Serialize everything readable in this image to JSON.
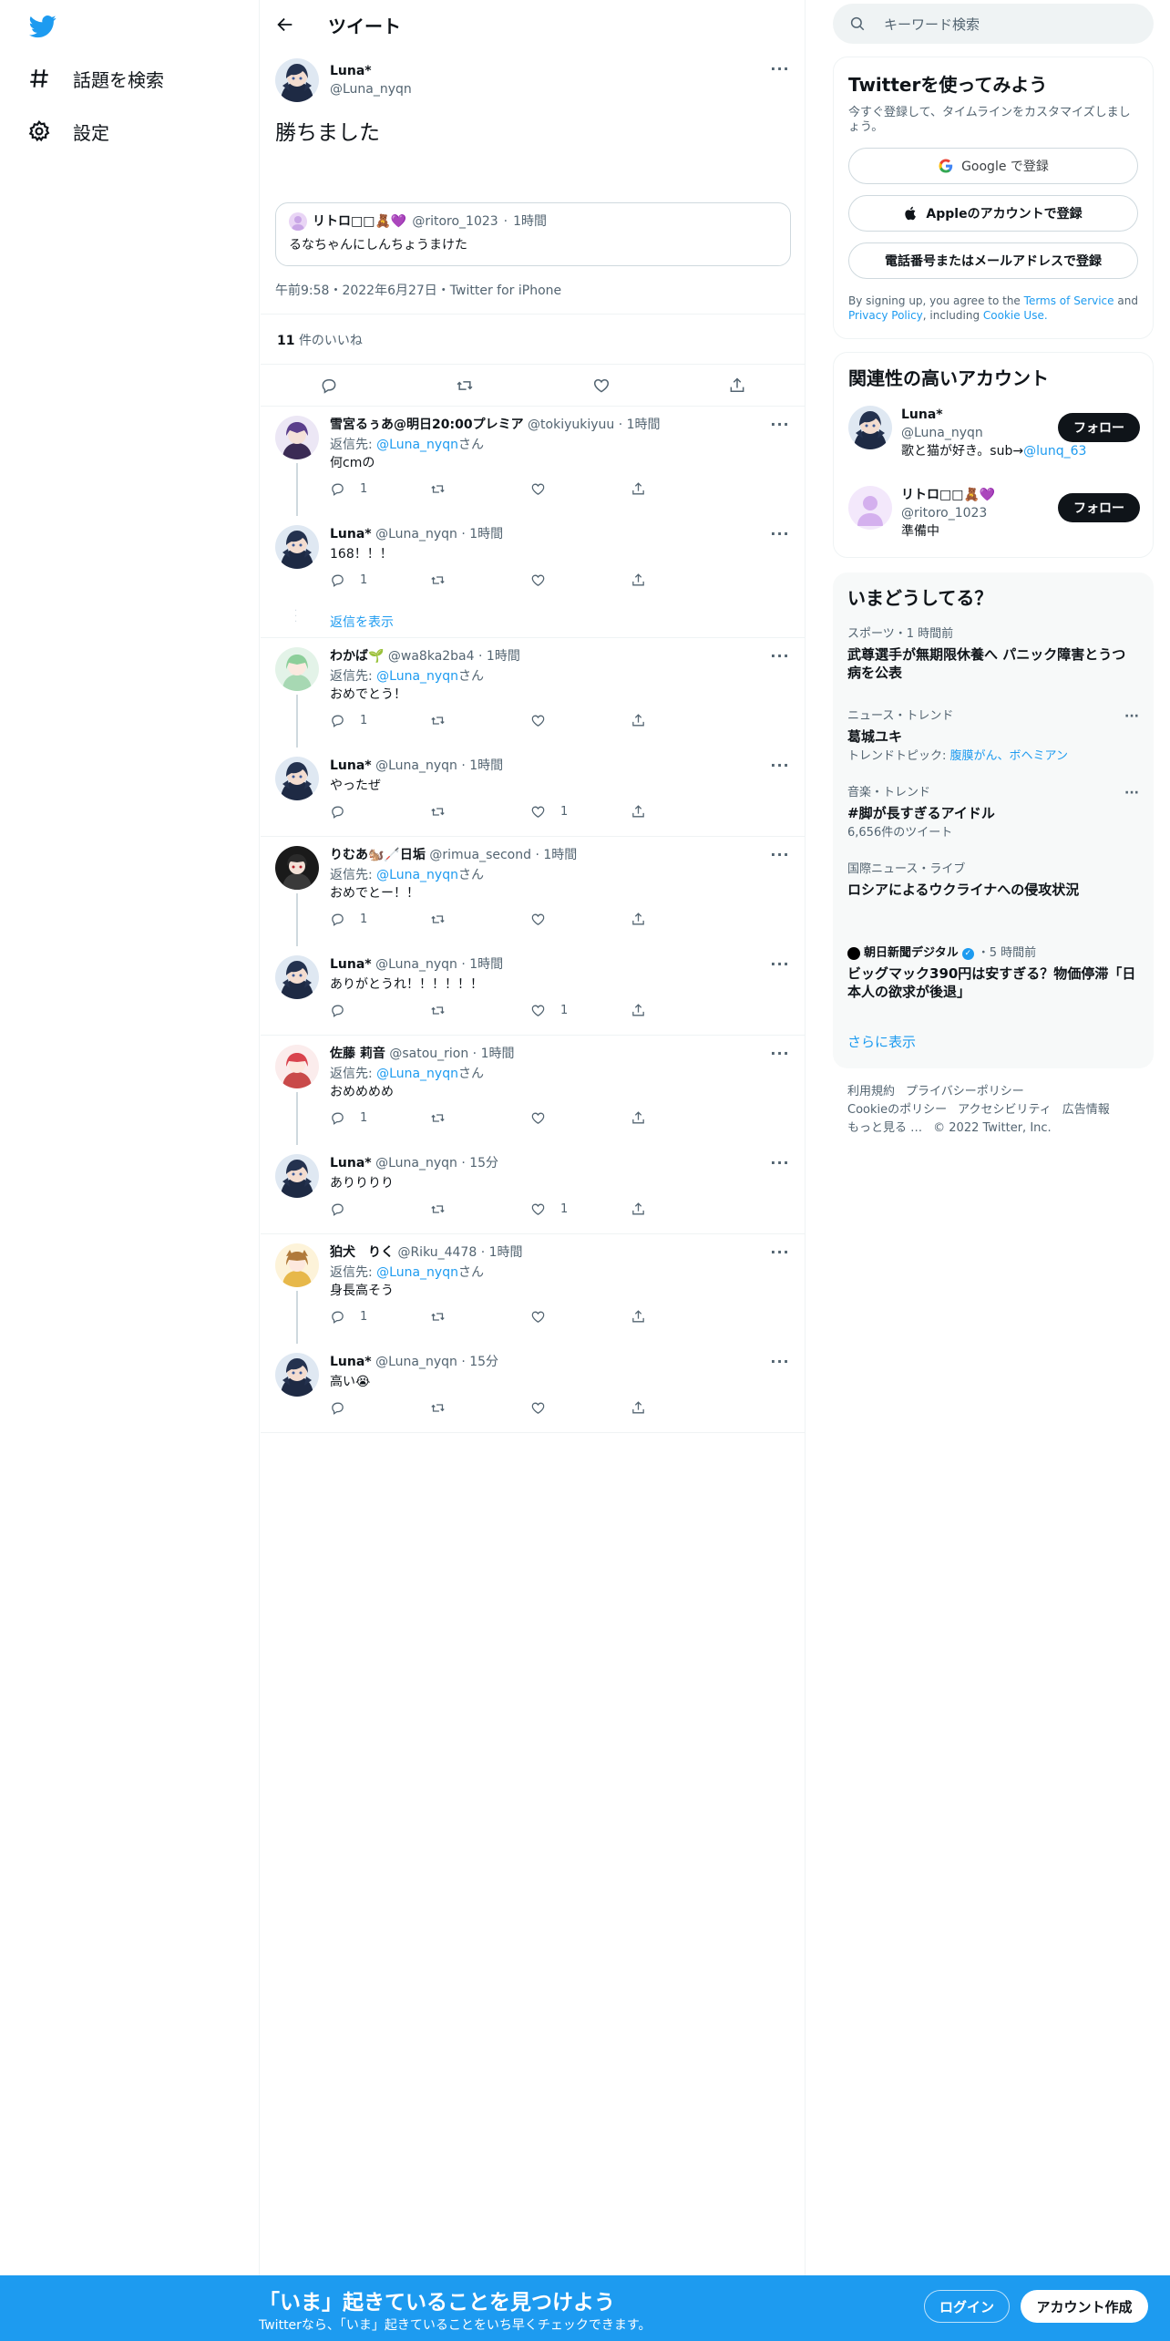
{
  "nav": {
    "explore_label": "話題を検索",
    "settings_label": "設定"
  },
  "header": {
    "title": "ツイート"
  },
  "focal": {
    "display_name": "Luna*",
    "handle": "@Luna_nyqn",
    "text": "勝ちました",
    "quote": {
      "display_name": "リトロ□□🧸💜",
      "handle": "@ritoro_1023",
      "time": "1時間",
      "text": "るなちゃんにしんちょうまけた"
    },
    "meta": "午前9:58・2022年6月27日・Twitter for iPhone",
    "likes_count": "11",
    "likes_label": "件のいいね"
  },
  "threads": [
    {
      "reply": {
        "display_name": "雪宮るぅあ@明日20:00プレミア",
        "handle": "@tokiyukiyuu",
        "time": "1時間",
        "reply_to_prefix": "返信先:",
        "reply_to_handle": "@Luna_nyqn",
        "reply_to_suffix": "さん",
        "text": "何cmの",
        "reply_count": "1",
        "like_count": ""
      },
      "answer": {
        "display_name": "Luna*",
        "handle": "@Luna_nyqn",
        "time": "1時間",
        "text": "168！！！",
        "reply_count": "1",
        "like_count": ""
      },
      "show_replies": "返信を表示"
    },
    {
      "reply": {
        "display_name": "わかば🌱",
        "handle": "@wa8ka2ba4",
        "time": "1時間",
        "reply_to_prefix": "返信先:",
        "reply_to_handle": "@Luna_nyqn",
        "reply_to_suffix": "さん",
        "text": "おめでとう！",
        "reply_count": "1",
        "like_count": ""
      },
      "answer": {
        "display_name": "Luna*",
        "handle": "@Luna_nyqn",
        "time": "1時間",
        "text": "やったぜ",
        "reply_count": "",
        "like_count": "1"
      }
    },
    {
      "reply": {
        "display_name": "りむあ🐿️🦯日垢",
        "handle": "@rimua_second",
        "time": "1時間",
        "reply_to_prefix": "返信先:",
        "reply_to_handle": "@Luna_nyqn",
        "reply_to_suffix": "さん",
        "text": "おめでとー！！",
        "reply_count": "1",
        "like_count": ""
      },
      "answer": {
        "display_name": "Luna*",
        "handle": "@Luna_nyqn",
        "time": "1時間",
        "text": "ありがとうれ！！！！！！",
        "reply_count": "",
        "like_count": "1"
      }
    },
    {
      "reply": {
        "display_name": "佐藤 莉音",
        "handle": "@satou_rion",
        "time": "1時間",
        "reply_to_prefix": "返信先:",
        "reply_to_handle": "@Luna_nyqn",
        "reply_to_suffix": "さん",
        "text": "おめめめめ",
        "reply_count": "1",
        "like_count": ""
      },
      "answer": {
        "display_name": "Luna*",
        "handle": "@Luna_nyqn",
        "time": "15分",
        "text": "ありりりり",
        "reply_count": "",
        "like_count": "1"
      }
    },
    {
      "reply": {
        "display_name": "狛犬　りく",
        "handle": "@Riku_4478",
        "time": "1時間",
        "reply_to_prefix": "返信先:",
        "reply_to_handle": "@Luna_nyqn",
        "reply_to_suffix": "さん",
        "text": "身長高そう",
        "reply_count": "1",
        "like_count": ""
      },
      "answer": {
        "display_name": "Luna*",
        "handle": "@Luna_nyqn",
        "time": "15分",
        "text": "高い😭",
        "reply_count": "",
        "like_count": ""
      }
    }
  ],
  "search": {
    "placeholder": "キーワード検索"
  },
  "signup_card": {
    "title": "Twitterを使ってみよう",
    "subtitle": "今すぐ登録して、タイムラインをカスタマイズしましょう。",
    "google_label": "Google で登録",
    "apple_label": "Appleのアカウントで登録",
    "phone_label": "電話番号またはメールアドレスで登録",
    "terms_prefix": "By signing up, you agree to the",
    "terms_link": "Terms of Service",
    "terms_and": "and",
    "privacy_link": "Privacy Policy",
    "terms_including": ", including",
    "cookie_link": "Cookie Use."
  },
  "related": {
    "title": "関連性の高いアカウント",
    "follow_label": "フォロー",
    "accounts": [
      {
        "display_name": "Luna*",
        "handle": "@Luna_nyqn",
        "bio": "歌と猫が好き。sub→",
        "bio_link": "@lunq_63"
      },
      {
        "display_name": "リトロ□□🧸💜",
        "handle": "@ritoro_1023",
        "bio": "準備中",
        "bio_link": ""
      }
    ]
  },
  "trends": {
    "title": "いまどうしてる？",
    "items": [
      {
        "context": "スポーツ・1 時間前",
        "title": "武尊選手が無期限休養へ パニック障害とうつ病を公表",
        "extra": ""
      },
      {
        "context": "ニュース・トレンド",
        "title": "葛城ユキ",
        "extra_prefix": "トレンドトピック:",
        "extra_links": "腹膜がん、ボヘミアン"
      },
      {
        "context": "音楽・トレンド",
        "title": "#脚が長すぎるアイドル",
        "extra": "6,656件のツイート"
      },
      {
        "context": "国際ニュース・ライブ",
        "title": "ロシアによるウクライナへの侵攻状況",
        "extra": ""
      },
      {
        "context_source": "朝日新聞デジタル",
        "context_time": "・5 時間前",
        "title": "ビッグマック390円は安すぎる？物価停滞「日本人の欲求が後退」"
      }
    ],
    "show_more": "さらに表示"
  },
  "footer": {
    "links": [
      "利用規約",
      "プライバシーポリシー",
      "Cookieのポリシー",
      "アクセシビリティ",
      "広告情報",
      "もっと見る …",
      "© 2022 Twitter, Inc."
    ]
  },
  "bottom_bar": {
    "title": "「いま」起きていることを見つけよう",
    "subtitle": "Twitterなら、「いま」起きていることをいち早くチェックできます。",
    "login_label": "ログイン",
    "signup_label": "アカウント作成"
  },
  "colors": {
    "accent": "#1d9bf0",
    "text": "#0f1419",
    "muted": "#536471",
    "border": "#eff3f4"
  }
}
